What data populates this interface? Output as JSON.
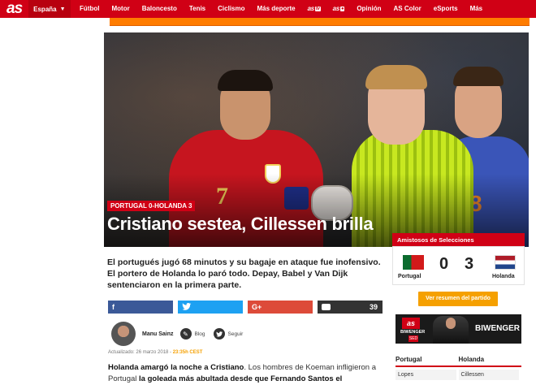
{
  "nav": {
    "logo": "as",
    "region": "España",
    "items": [
      "Fútbol",
      "Motor",
      "Baloncesto",
      "Tenis",
      "Ciclismo",
      "Más deporte"
    ],
    "brand1": "as",
    "brand1_tag": "tv",
    "brand2": "as",
    "brand2_tag": "●",
    "items2": [
      "Opinión",
      "AS Color",
      "eSports",
      "Más"
    ]
  },
  "hero": {
    "kicker": "PORTUGAL 0-HOLANDA 3",
    "headline": "Cristiano sestea, Cillessen brilla",
    "p1_number": "7",
    "p3_number": "8"
  },
  "match": {
    "competition": "Amistosos de Selecciones",
    "home": "Portugal",
    "away": "Holanda",
    "home_score": "0",
    "away_score": "3",
    "summary_button": "Ver resumen del partido",
    "home_flag_colors": [
      "#0b6b2e",
      "#d21a1a"
    ],
    "away_flag_colors": [
      "#ae1c28",
      "#ffffff",
      "#21468b"
    ]
  },
  "banner": {
    "logo": "as",
    "small": "BIWENGER",
    "seal": "SED",
    "brand": "BIWENGER"
  },
  "lineups": {
    "home_header": "Portugal",
    "away_header": "Holanda",
    "home_first": "Lopes",
    "away_first": "Cillessen"
  },
  "article": {
    "lead": "El portugués jugó 68 minutos y su bagaje en ataque fue inofensivo. El portero de Holanda lo paró todo. Depay, Babel y Van Dijk sentenciaron en la primera parte.",
    "share": {
      "facebook_icon": "f",
      "twitter_icon": "twitter-bird",
      "gplus_icon": "G+",
      "comments": "39"
    },
    "author": "Manu Sainz",
    "blog_label": "Blog",
    "follow_label": "Seguir",
    "updated_prefix": "Actualizado: 26 marzo 2018 - ",
    "updated_time": "23:35h CEST",
    "body_b1": "Holanda amargó la noche a Cristiano",
    "body_t1": ". Los hombres de Koeman infligieron a Portugal ",
    "body_b2": "la goleada más abultada desde que Fernando Santos el seleccionador",
    "body_t2": "."
  },
  "colors": {
    "brand_red": "#d00015",
    "accent_orange": "#f5a000"
  }
}
